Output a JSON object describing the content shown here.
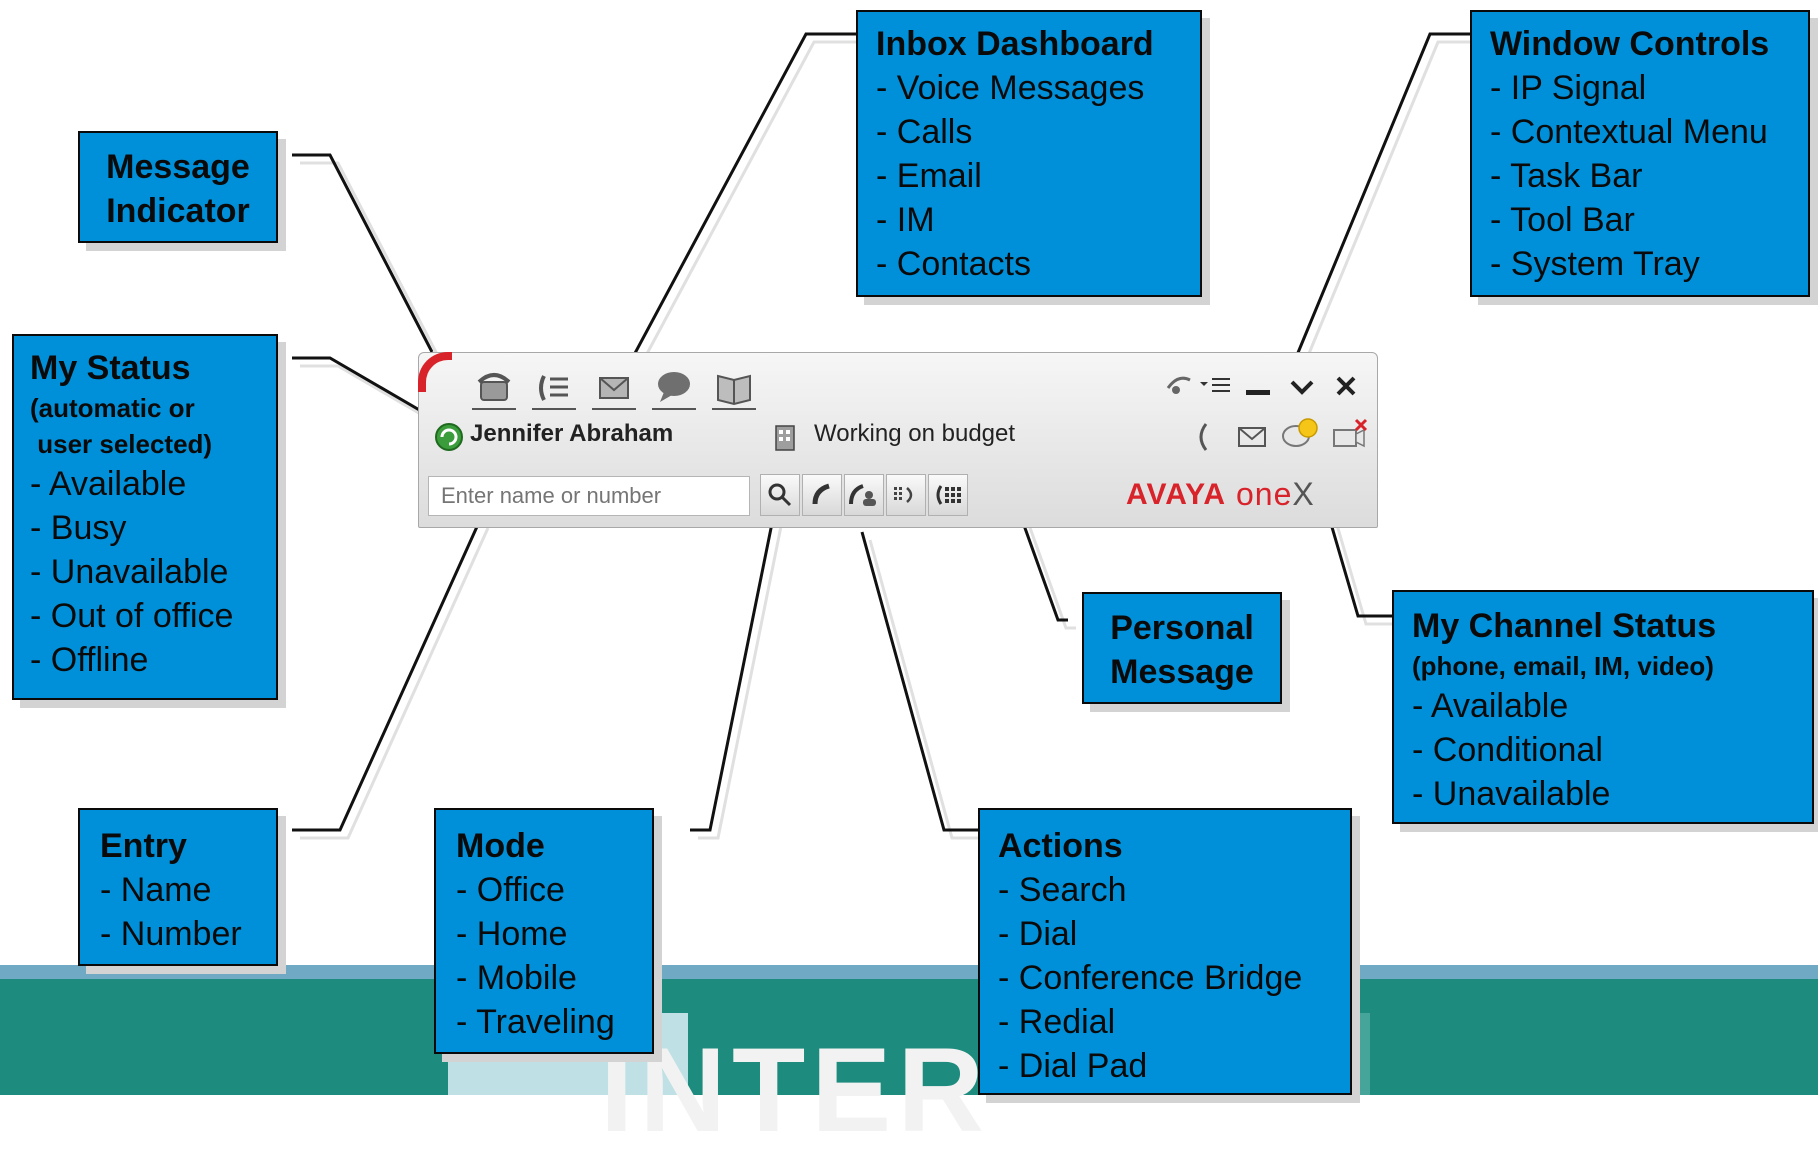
{
  "window": {
    "user_name": "Jennifer Abraham",
    "personal_message": "Working on budget",
    "entry_placeholder": "Enter name or number",
    "brand": "AVAYA",
    "product": "one",
    "product_x": "X"
  },
  "callouts": {
    "message_indicator": {
      "title_line1": "Message",
      "title_line2": "Indicator"
    },
    "inbox": {
      "title": "Inbox Dashboard",
      "items": [
        "- Voice Messages",
        "- Calls",
        "- Email",
        "- IM",
        "- Contacts"
      ]
    },
    "window_controls": {
      "title": "Window Controls",
      "items": [
        "- IP Signal",
        "- Contextual Menu",
        "- Task Bar",
        "- Tool Bar",
        "- System Tray"
      ]
    },
    "my_status": {
      "title": "My Status",
      "sub1": "(automatic or",
      "sub2": " user selected)",
      "items": [
        "- Available",
        "- Busy",
        "- Unavailable",
        "- Out of office",
        "- Offline"
      ]
    },
    "personal_message": {
      "title_line1": "Personal",
      "title_line2": "Message"
    },
    "channel_status": {
      "title": "My Channel Status",
      "sub": "(phone, email, IM, video)",
      "items": [
        "- Available",
        "- Conditional",
        "- Unavailable"
      ]
    },
    "entry": {
      "title": "Entry",
      "items": [
        "- Name",
        "- Number"
      ]
    },
    "mode": {
      "title": "Mode",
      "items": [
        "- Office",
        "- Home",
        "- Mobile",
        "- Traveling"
      ]
    },
    "actions": {
      "title": "Actions",
      "items": [
        "- Search",
        "- Dial",
        "- Conference Bridge",
        "- Redial",
        "- Dial Pad"
      ]
    }
  },
  "banner": {
    "word": "INTER"
  },
  "colors": {
    "callout_fill": "#0090da",
    "banner": "#1d8b7d",
    "brand_red": "#d8232a"
  }
}
